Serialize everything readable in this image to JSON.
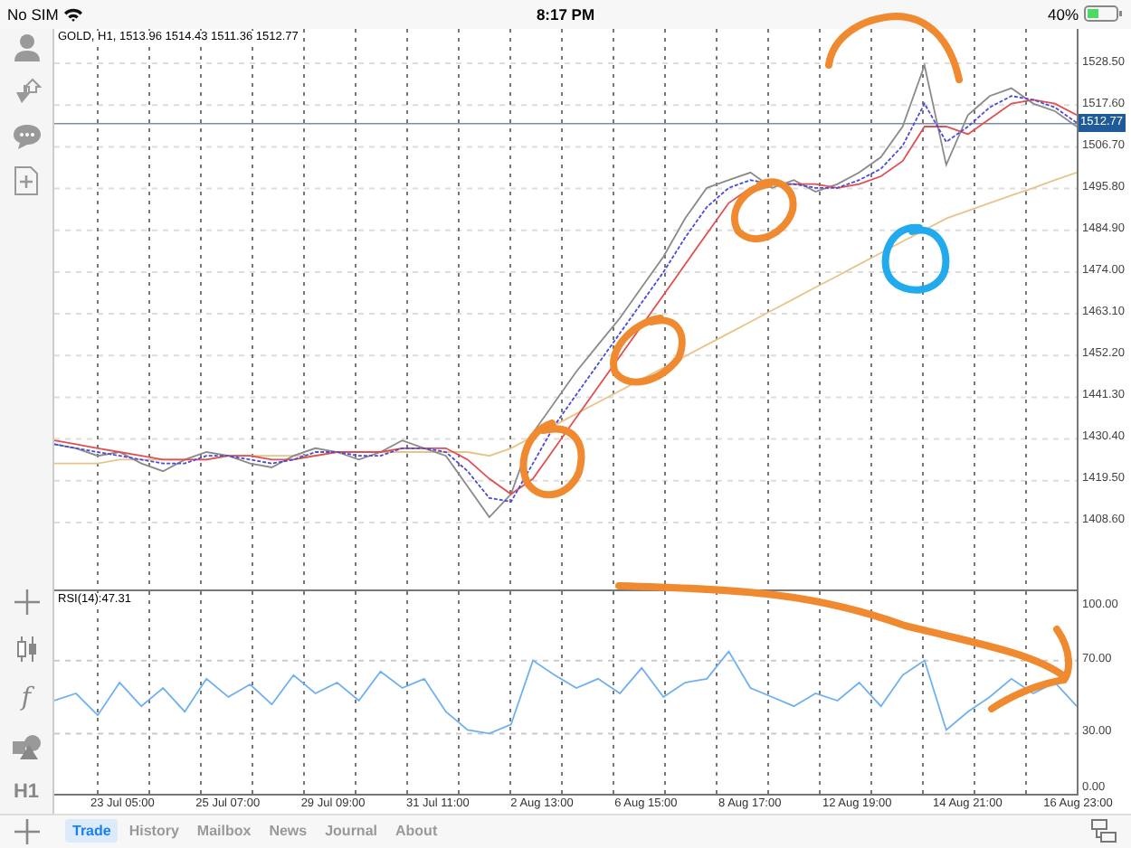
{
  "status_bar": {
    "carrier": "No SIM",
    "time": "8:17 PM",
    "battery": "40%"
  },
  "left_toolbar": {
    "tools": [
      {
        "kind": "crosshair"
      },
      {
        "kind": "candles"
      },
      {
        "kind": "glyph",
        "text": "f"
      },
      {
        "kind": "shapes"
      },
      {
        "kind": "glyph",
        "text": "H1"
      }
    ]
  },
  "chart": {
    "header": "GOLD, H1, 1513.96 1514.43 1511.36 1512.77",
    "chart_data": {
      "type": "line",
      "ylim": [
        1391.1,
        1537.5
      ],
      "grid": true,
      "ref_lines": [
        {
          "axis": "y",
          "value": 1512.77,
          "label": "1512.77",
          "color": "#7a8fa6"
        }
      ],
      "yticks": [
        {
          "value": 1528.5,
          "label": "1528.50"
        },
        {
          "value": 1517.6,
          "label": "1517.60"
        },
        {
          "value": 1506.7,
          "label": "1506.70"
        },
        {
          "value": 1495.8,
          "label": "1495.80"
        },
        {
          "value": 1484.9,
          "label": "1484.90"
        },
        {
          "value": 1474,
          "label": "1474.00"
        },
        {
          "value": 1463.1,
          "label": "1463.10"
        },
        {
          "value": 1452.2,
          "label": "1452.20"
        },
        {
          "value": 1441.3,
          "label": "1441.30"
        },
        {
          "value": 1430.4,
          "label": "1430.40"
        },
        {
          "value": 1419.5,
          "label": "1419.50"
        },
        {
          "value": 1408.6,
          "label": "1408.60"
        }
      ],
      "series": [
        {
          "color": "#8a8a8a",
          "values": [
            1429,
            1428,
            1426,
            1427,
            1424,
            1422,
            1425,
            1427,
            1426,
            1424,
            1423,
            1426,
            1428,
            1427,
            1425,
            1427,
            1430,
            1428,
            1426,
            1418,
            1410,
            1416,
            1432,
            1440,
            1448,
            1455,
            1462,
            1470,
            1478,
            1488,
            1496,
            1498,
            1500,
            1496,
            1498,
            1495,
            1497,
            1500,
            1504,
            1512,
            1528,
            1502,
            1515,
            1520,
            1522,
            1518,
            1516,
            1512
          ]
        },
        {
          "color": "#e05050",
          "values": [
            1430,
            1429,
            1428,
            1427,
            1426,
            1425,
            1425,
            1425,
            1426,
            1426,
            1425,
            1425,
            1426,
            1427,
            1427,
            1427,
            1428,
            1428,
            1428,
            1425,
            1420,
            1416,
            1420,
            1428,
            1436,
            1444,
            1452,
            1460,
            1468,
            1476,
            1484,
            1492,
            1496,
            1497,
            1497,
            1497,
            1496,
            1497,
            1499,
            1503,
            1512,
            1512,
            1510,
            1514,
            1518,
            1519,
            1518,
            1515
          ]
        },
        {
          "color": "#4a4adf",
          "line_style": "dashed",
          "values": [
            1429,
            1428,
            1427,
            1426,
            1425,
            1424,
            1424,
            1426,
            1426,
            1425,
            1424,
            1425,
            1427,
            1427,
            1426,
            1426,
            1428,
            1428,
            1427,
            1422,
            1415,
            1414,
            1424,
            1434,
            1442,
            1450,
            1458,
            1466,
            1474,
            1483,
            1491,
            1496,
            1498,
            1497,
            1497,
            1496,
            1496,
            1498,
            1501,
            1507,
            1518,
            1508,
            1512,
            1517,
            1520,
            1519,
            1517,
            1513
          ]
        },
        {
          "color": "#e8c48a",
          "values": [
            1424,
            1424,
            1424,
            1425,
            1425,
            1425,
            1425,
            1425,
            1426,
            1426,
            1426,
            1426,
            1426,
            1427,
            1427,
            1427,
            1427,
            1427,
            1427,
            1427,
            1426,
            1428,
            1431,
            1434,
            1437,
            1440,
            1443,
            1446,
            1449,
            1452,
            1455,
            1458,
            1461,
            1464,
            1467,
            1470,
            1473,
            1476,
            1479,
            1482,
            1485,
            1488,
            1490,
            1492,
            1494,
            1496,
            1498,
            1500
          ]
        }
      ]
    }
  },
  "rsi": {
    "header": "RSI(14):47.31",
    "chart_data": {
      "type": "line",
      "ylim": [
        -3,
        108
      ],
      "grid": true,
      "yticks": [
        {
          "value": 100,
          "label": "100.00"
        },
        {
          "value": 70,
          "label": "70.00"
        },
        {
          "value": 30,
          "label": "30.00"
        },
        {
          "value": 0,
          "label": "0.00"
        }
      ],
      "series": [
        {
          "color": "#6fb0f0",
          "values": [
            48,
            52,
            40,
            58,
            45,
            55,
            42,
            60,
            50,
            57,
            46,
            62,
            52,
            58,
            48,
            64,
            55,
            60,
            42,
            32,
            30,
            35,
            70,
            62,
            55,
            60,
            52,
            66,
            50,
            58,
            60,
            75,
            55,
            50,
            45,
            52,
            48,
            58,
            45,
            62,
            70,
            32,
            42,
            50,
            60,
            52,
            58,
            45
          ]
        }
      ]
    }
  },
  "time_labels": [
    "23 Jul 05:00",
    "25 Jul 07:00",
    "29 Jul 09:00",
    "31 Jul 11:00",
    "2 Aug 13:00",
    "6 Aug 15:00",
    "8 Aug 17:00",
    "12 Aug 19:00",
    "14 Aug 21:00",
    "16 Aug 23:00"
  ],
  "tabs": [
    {
      "label": "Trade",
      "selected": true
    },
    {
      "label": "History",
      "selected": false
    },
    {
      "label": "Mailbox",
      "selected": false
    },
    {
      "label": "News",
      "selected": false
    },
    {
      "label": "Journal",
      "selected": false
    },
    {
      "label": "About",
      "selected": false
    }
  ]
}
